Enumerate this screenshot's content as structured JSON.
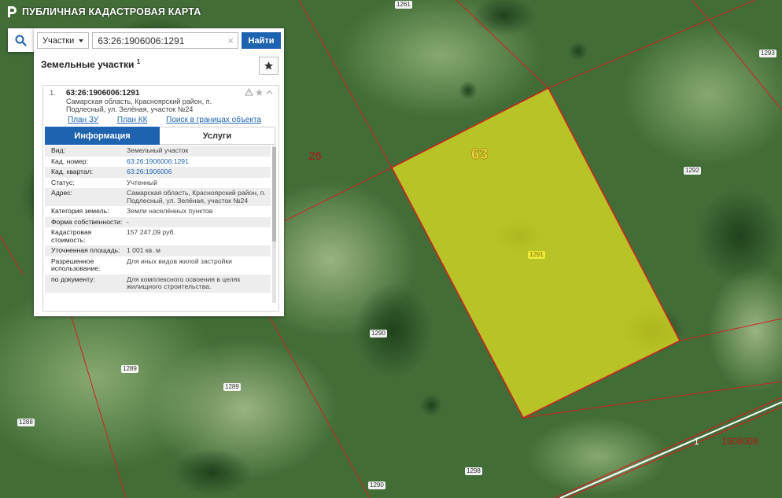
{
  "app": {
    "title": "ПУБЛИЧНАЯ КАДАСТРОВАЯ КАРТА"
  },
  "search": {
    "type_label": "Участки",
    "value": "63:26:1906006:1291",
    "button_label": "Найти"
  },
  "results": {
    "title": "Земельные участки",
    "count": "1",
    "item": {
      "number": "1.",
      "cad_number": "63:26:1906006:1291",
      "address": "Самарская область, Красноярский район, п. Подлесный, ул. Зелёная, участок №24",
      "links": [
        "План ЗУ →",
        "План КК →",
        "Поиск в границах объекта →"
      ],
      "tabs": [
        "Информация",
        "Услуги"
      ],
      "rows": [
        {
          "key": "Вид:",
          "value": "Земельный участок",
          "is_link": false
        },
        {
          "key": "Кад. номер:",
          "value": "63:26:1906006:1291",
          "is_link": true
        },
        {
          "key": "Кад. квартал:",
          "value": "63:26:1906006",
          "is_link": true
        },
        {
          "key": "Статус:",
          "value": "Учтенный",
          "is_link": false
        },
        {
          "key": "Адрес:",
          "value": "Самарская область, Красноярский район, п. Подлесный, ул. Зелёная, участок №24",
          "is_link": false
        },
        {
          "key": "Категория земель:",
          "value": "Земли населённых пунктов",
          "is_link": false
        },
        {
          "key": "Форма собственности:",
          "value": "-",
          "is_link": false
        },
        {
          "key": "Кадастровая стоимость:",
          "value": "157 247,09 руб.",
          "is_link": false
        },
        {
          "key": "Уточненная площадь:",
          "value": "1 001 кв. м",
          "is_link": false
        },
        {
          "key": "Разрешенное использование:",
          "value": "Для иных видов жилой застройки",
          "is_link": false
        },
        {
          "key": "по документу:",
          "value": "Для комплексного освоения в целях жилищного строительства.",
          "is_link": false
        }
      ]
    }
  },
  "map": {
    "parcel_labels": [
      "1261",
      "1293",
      "1292",
      "1291",
      "1290",
      "1289",
      "1289",
      "1288",
      "1290",
      "1298"
    ],
    "zone_labels": [
      "26",
      "63"
    ],
    "quarter_labels": [
      "1",
      "1906008"
    ],
    "colors": {
      "selected_fill": "#e5e520",
      "boundary": "#d02020",
      "zone_label": "#b01818"
    }
  }
}
